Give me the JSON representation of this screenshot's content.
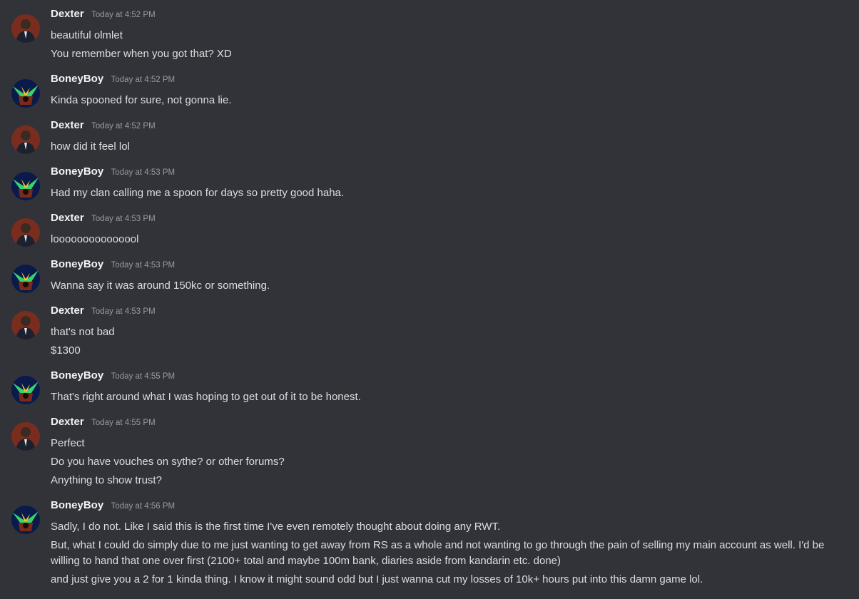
{
  "messages": [
    {
      "author": "Dexter",
      "time": "Today at 4:52 PM",
      "lines": [
        "beautiful olmlet",
        "You remember when you got that? XD"
      ]
    },
    {
      "author": "BoneyBoy",
      "time": "Today at 4:52 PM",
      "lines": [
        "Kinda spooned for sure, not gonna lie."
      ]
    },
    {
      "author": "Dexter",
      "time": "Today at 4:52 PM",
      "lines": [
        "how did it feel lol"
      ]
    },
    {
      "author": "BoneyBoy",
      "time": "Today at 4:53 PM",
      "lines": [
        "Had my clan calling me a spoon for days so pretty good haha."
      ]
    },
    {
      "author": "Dexter",
      "time": "Today at 4:53 PM",
      "lines": [
        "looooooooooooool"
      ]
    },
    {
      "author": "BoneyBoy",
      "time": "Today at 4:53 PM",
      "lines": [
        "Wanna say it was around 150kc or something."
      ]
    },
    {
      "author": "Dexter",
      "time": "Today at 4:53 PM",
      "lines": [
        "that's not bad",
        "$1300"
      ]
    },
    {
      "author": "BoneyBoy",
      "time": "Today at 4:55 PM",
      "lines": [
        "That's right around what I was hoping to get out of it to be honest."
      ]
    },
    {
      "author": "Dexter",
      "time": "Today at 4:55 PM",
      "lines": [
        "Perfect",
        "Do you have vouches on sythe? or other forums?",
        "Anything to show trust?"
      ]
    },
    {
      "author": "BoneyBoy",
      "time": "Today at 4:56 PM",
      "lines": [
        "Sadly, I do not. Like I said this is the first time I've even remotely thought about doing any RWT.",
        "But, what I could do simply due to me just wanting to get away from RS as a whole and not wanting to go through the pain of selling my main account as well. I'd be willing to hand that one over first (2100+ total and maybe 100m bank, diaries aside from kandarin etc. done)",
        "and just give you a 2 for 1 kinda thing. I know it might sound odd but I just wanna cut my losses of 10k+ hours put into this damn game lol."
      ]
    }
  ],
  "avatars": {
    "Dexter": "person-avatar-icon",
    "BoneyBoy": "game-character-avatar-icon"
  },
  "colors": {
    "background": "#313338",
    "username": "#f2f3f5",
    "timestamp": "#949ba4",
    "text": "#dbdee1"
  }
}
